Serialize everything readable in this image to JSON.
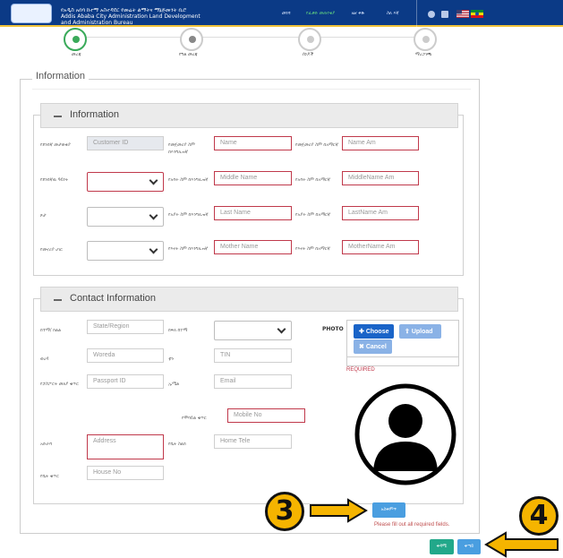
{
  "header": {
    "brand_line1": "የአዲስ አበባ ከተማ አስተዳደር የመሬት ልማትና ማኔጅመንት ቢሮ",
    "brand_line2": "Addis Ababa City Administration Land Development",
    "brand_line3": "and Administration Bureau",
    "nav": [
      "መነሻ",
      "የፈቃድ መጠየቂያ",
      "ዜና ቅጽ",
      "ስለ እኛ"
    ],
    "brand_color": "#0b3a86"
  },
  "steps": [
    {
      "label": "መረጃ",
      "icon": "info-icon"
    },
    {
      "label": "የግል መረጃ",
      "icon": "user-icon"
    },
    {
      "label": "ሰነዶች",
      "icon": "document-icon"
    },
    {
      "label": "ማረጋገጫ",
      "icon": "check-icon"
    }
  ],
  "outer_title": "Information",
  "info_panel": {
    "title": "Information",
    "labels": {
      "customer_id": "የደንበኛ መታወቂያ",
      "name": "የመጀመሪያ ስም በእንግሊዝኛ",
      "name_am": "የመጀመሪያ ስም በአማርኛ",
      "customer_type": "የደንበኛዉ ዓይነት",
      "middle_name": "የአባት ስም በእንግሊዝኛ",
      "middle_name_am": "የአባት ስም በአማርኛ",
      "gender": "ጾታ",
      "last_name": "የአያት ስም በእንግሊዝኛ",
      "last_name_am": "የአያት ስም በአማርኛ",
      "nationality": "የመኖሪያ ሀገር",
      "mother_name": "የእናት ስም በእንግሊዝኛ",
      "mother_name_am": "የእናት ስም በአማርኛ"
    },
    "placeholders": {
      "customer_id": "Customer ID",
      "name": "Name",
      "name_am": "Name Am",
      "middle_name": "Middle Name",
      "middle_name_am": "MiddleName Am",
      "last_name": "Last Name",
      "last_name_am": "LastName Am",
      "mother_name": "Mother Name",
      "mother_name_am": "MotherName Am"
    }
  },
  "contact_panel": {
    "title": "Contact Information",
    "labels": {
      "region": "ክተማ/ ክልል",
      "subcity": "ክፍለ ከተማ",
      "photo": "PHOTO",
      "woreda": "ወረዳ",
      "tin": "ቲን",
      "passport": "የፓስፖርት መለያ ቁጥር",
      "email": "ኢሜል",
      "mobile": "የሞባይል ቁጥር",
      "address": "አድራሻ",
      "home_tel": "የቤት ስልክ",
      "house_no": "የቤት ቁጥር"
    },
    "placeholders": {
      "region": "State/Region",
      "woreda": "Woreda",
      "tin": "TIN",
      "passport": "Passport ID",
      "email": "Email",
      "mobile": "Mobile No",
      "address": "Address",
      "home_tel": "Home Tele",
      "house_no": "House No"
    },
    "photo_buttons": {
      "choose": "Choose",
      "upload": "Upload",
      "cancel": "Cancel"
    },
    "required_text": "REQUIRED"
  },
  "actions": {
    "submit": "አስቀምጥ",
    "warning": "Please fill out all required fields.",
    "prev": "ቀዳሚ",
    "next": "ቀጣይ"
  },
  "annotations": {
    "badge_3": "3",
    "badge_4": "4"
  },
  "colors": {
    "required_border": "#c0394b",
    "primary": "#1a64c8",
    "badge": "#f5b400"
  }
}
